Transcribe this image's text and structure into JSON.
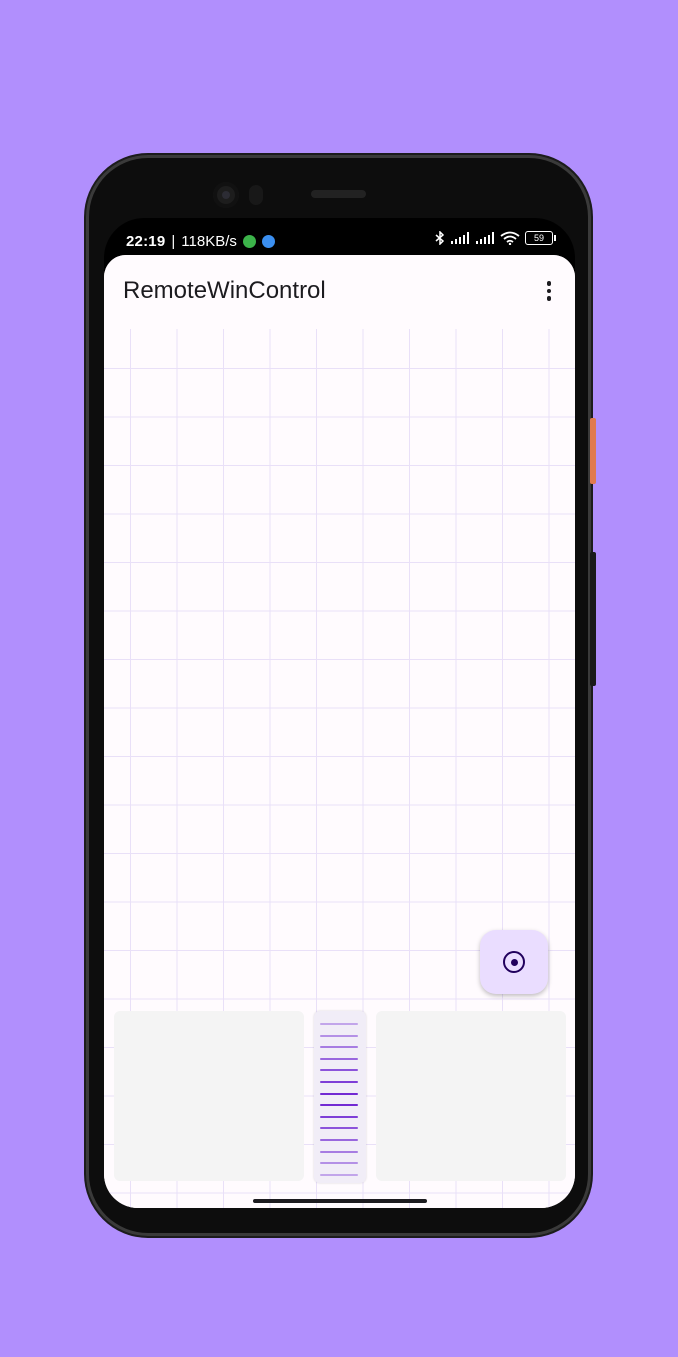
{
  "status_bar": {
    "time": "22:19",
    "separator": "|",
    "speed": "118KB/s",
    "battery": "59",
    "icons": [
      "wechat-icon",
      "sync-icon",
      "bluetooth-icon",
      "signal-icon",
      "signal-icon",
      "wifi-icon",
      "battery-icon"
    ]
  },
  "app_bar": {
    "title": "RemoteWinControl",
    "menu_icon": "more-vert-icon"
  },
  "fab": {
    "icon": "radio-button-icon"
  },
  "colors": {
    "background": "#b18ffd",
    "surface": "#fffbfe",
    "grid": "#e9e0f8",
    "fab": "#eaddff",
    "accent": "#6a1fd1",
    "mouse_button": "#f4f4f4"
  }
}
